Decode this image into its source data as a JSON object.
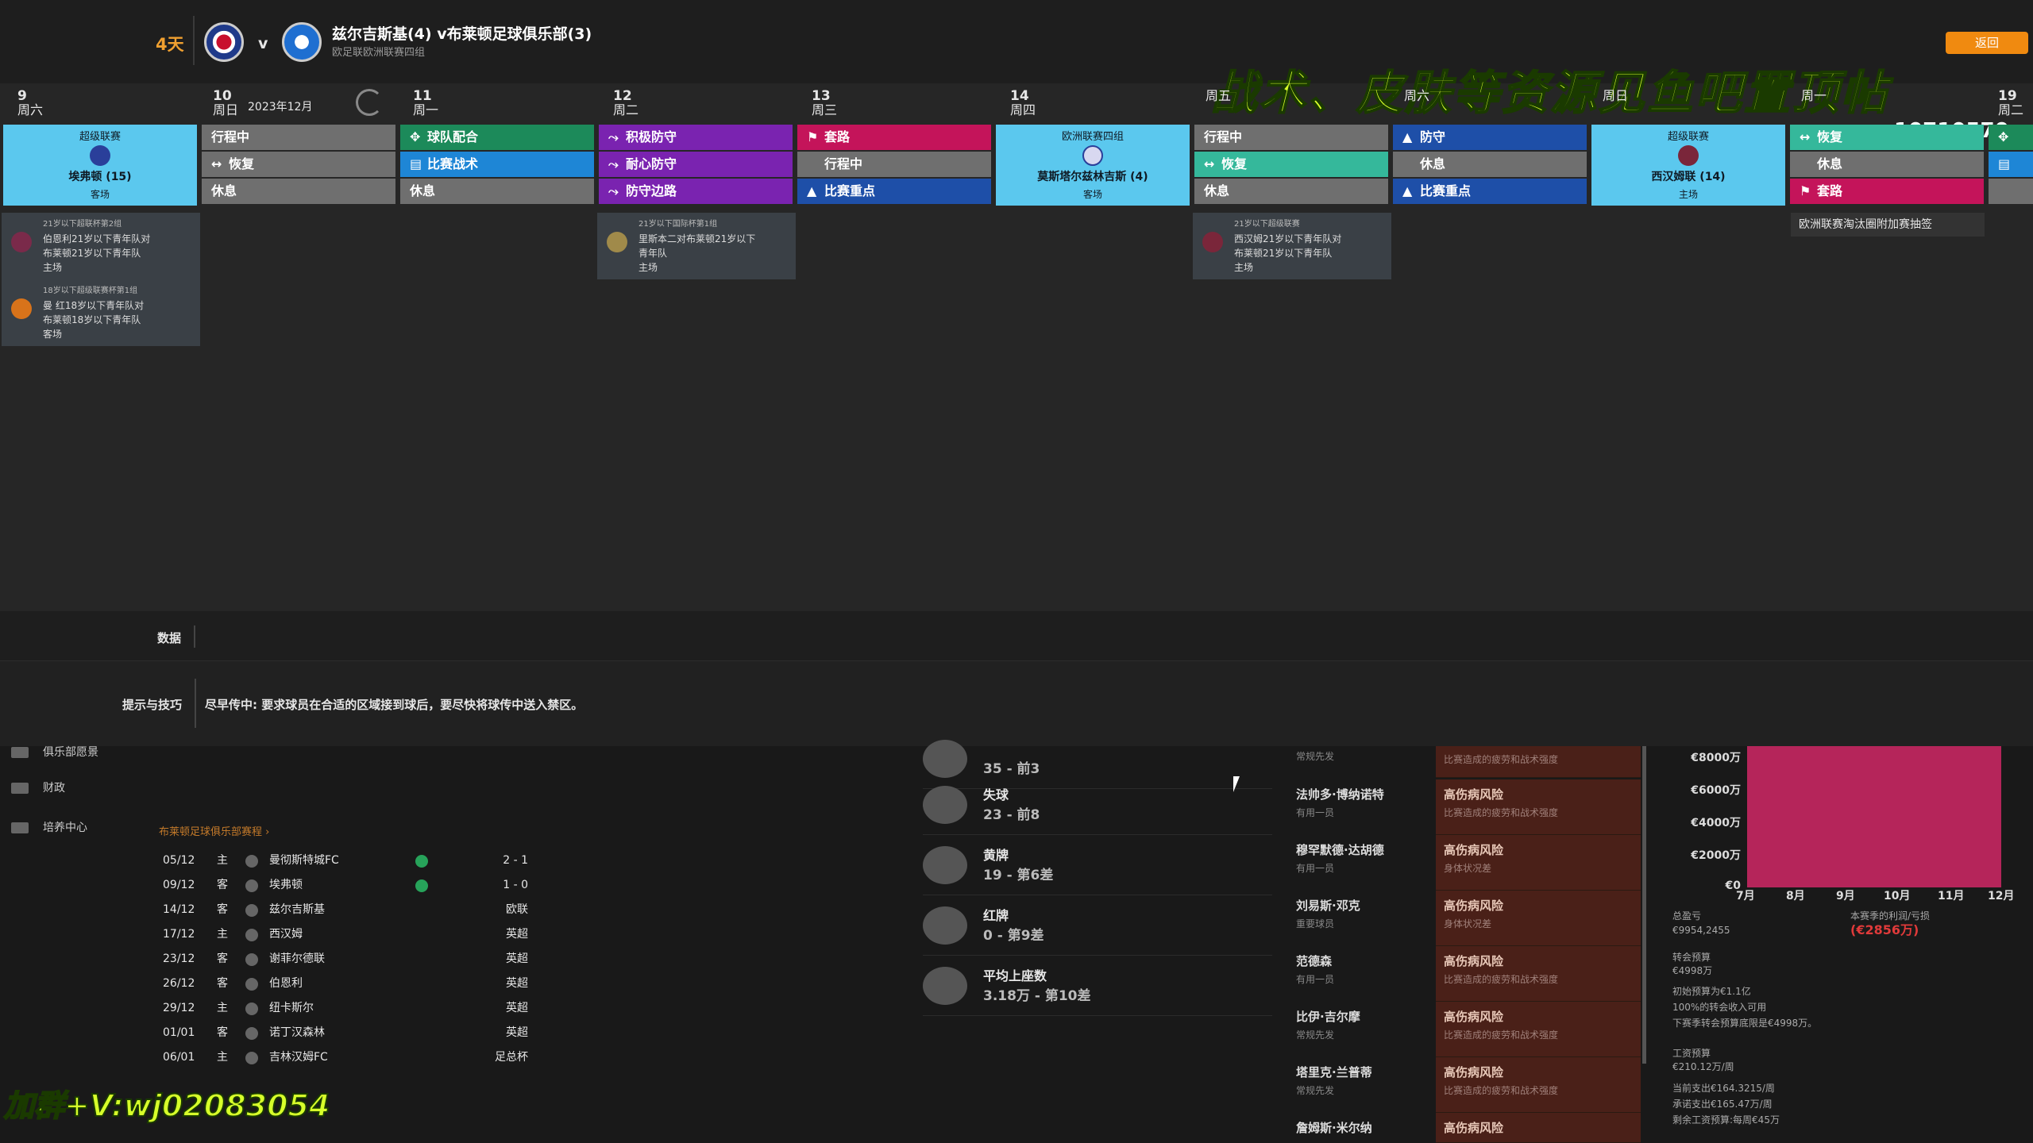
{
  "header": {
    "days_left": "4天",
    "vs": "v",
    "match_title": "兹尔吉斯基(4) v布莱顿足球俱乐部(3)",
    "competition": "欧足联欧洲联赛四组",
    "month": "2023年12月",
    "overlay_text": "战术、皮肤等资源见鱼吧置顶帖",
    "corner_button": "返回",
    "corner_number": "10710570"
  },
  "days": [
    {
      "num": "9",
      "wd": "周六"
    },
    {
      "num": "10",
      "wd": "周日"
    },
    {
      "num": "11",
      "wd": "周一"
    },
    {
      "num": "12",
      "wd": "周二"
    },
    {
      "num": "13",
      "wd": "周三"
    },
    {
      "num": "14",
      "wd": "周四"
    },
    {
      "num": "",
      "wd": "周五"
    },
    {
      "num": "",
      "wd": "周六"
    },
    {
      "num": "",
      "wd": "周日"
    },
    {
      "num": "",
      "wd": "周一"
    },
    {
      "num": "19",
      "wd": "周二"
    }
  ],
  "schedule": {
    "sat9": {
      "comp": "超级联赛",
      "opp": "埃弗顿 (15)",
      "venue": "客场"
    },
    "sun10": [
      "行程中",
      "恢复",
      "休息"
    ],
    "mon11": [
      "球队配合",
      "比赛战术",
      "休息"
    ],
    "tue12": [
      "积极防守",
      "耐心防守",
      "防守边路"
    ],
    "wed13": [
      "套路",
      "行程中",
      "比赛重点"
    ],
    "thu14": {
      "comp": "欧洲联赛四组",
      "opp": "莫斯塔尔兹林吉斯 (4)",
      "venue": "客场"
    },
    "fri": [
      "行程中",
      "恢复",
      "休息"
    ],
    "sat": [
      "防守",
      "休息",
      "比赛重点"
    ],
    "sun": {
      "comp": "超级联赛",
      "opp": "西汉姆联 (14)",
      "venue": "主场"
    },
    "mon": [
      "恢复",
      "休息",
      "套路"
    ]
  },
  "youth": [
    {
      "comp": "21岁以下超联杯第2组",
      "line1": "伯恩利21岁以下青年队对",
      "line2": "布莱顿21岁以下青年队",
      "venue": "主场"
    },
    {
      "comp": "18岁以下超级联赛杯第1组",
      "line1": "曼 红18岁以下青年队对",
      "line2": "布莱顿18岁以下青年队",
      "venue": "客场"
    },
    {
      "comp": "21岁以下国际杯第1组",
      "line1": "里斯本二对布莱顿21岁以下",
      "line2": "青年队",
      "venue": "主场"
    },
    {
      "comp": "21岁以下超级联赛",
      "line1": "西汉姆21岁以下青年队对",
      "line2": "布莱顿21岁以下青年队",
      "venue": "主场"
    }
  ],
  "cup_tag": "欧洲联赛淘汰圈附加赛抽签",
  "data_tab": "数据",
  "tips": {
    "label": "提示与技巧",
    "text": "尽早传中: 要求球员在合适的区域接到球后，要尽快将球传中送入禁区。"
  },
  "nav": [
    "俱乐部愿景",
    "财政",
    "培养中心"
  ],
  "fixtures_link": "布莱顿足球俱乐部赛程 ›",
  "fixtures": [
    {
      "date": "05/12",
      "venue": "主",
      "opp": "曼彻斯特城FC",
      "res": "2 - 1",
      "win": true
    },
    {
      "date": "09/12",
      "venue": "客",
      "opp": "埃弗顿",
      "res": "1 - 0",
      "win": true
    },
    {
      "date": "14/12",
      "venue": "客",
      "opp": "兹尔吉斯基",
      "res": "欧联",
      "win": false
    },
    {
      "date": "17/12",
      "venue": "主",
      "opp": "西汉姆",
      "res": "英超",
      "win": false
    },
    {
      "date": "23/12",
      "venue": "客",
      "opp": "谢菲尔德联",
      "res": "英超",
      "win": false
    },
    {
      "date": "26/12",
      "venue": "客",
      "opp": "伯恩利",
      "res": "英超",
      "win": false
    },
    {
      "date": "29/12",
      "venue": "主",
      "opp": "纽卡斯尔",
      "res": "英超",
      "win": false
    },
    {
      "date": "01/01",
      "venue": "客",
      "opp": "诺丁汉森林",
      "res": "英超",
      "win": false
    },
    {
      "date": "06/01",
      "venue": "主",
      "opp": "吉林汉姆FC",
      "res": "足总杯",
      "win": false
    }
  ],
  "stats": [
    {
      "label": "",
      "value": "35 - 前3"
    },
    {
      "label": "失球",
      "value": "23 - 前8"
    },
    {
      "label": "黄牌",
      "value": "19 - 第6差"
    },
    {
      "label": "红牌",
      "value": "0 - 第9差"
    },
    {
      "label": "平均上座数",
      "value": "3.18万 - 第10差"
    }
  ],
  "players": [
    {
      "name": "",
      "role": "常规先发",
      "risk": "",
      "detail": "比赛造成的疲劳和战术强度"
    },
    {
      "name": "法帅多·博纳诺特",
      "role": "有用一员",
      "risk": "高伤病风险",
      "detail": "比赛造成的疲劳和战术强度"
    },
    {
      "name": "穆罕默德·达胡德",
      "role": "有用一员",
      "risk": "高伤病风险",
      "detail": "身体状况差"
    },
    {
      "name": "刘易斯·邓克",
      "role": "重要球员",
      "risk": "高伤病风险",
      "detail": "身体状况差"
    },
    {
      "name": "范德森",
      "role": "有用一员",
      "risk": "高伤病风险",
      "detail": "比赛造成的疲劳和战术强度"
    },
    {
      "name": "比伊·吉尔摩",
      "role": "常规先发",
      "risk": "高伤病风险",
      "detail": "比赛造成的疲劳和战术强度"
    },
    {
      "name": "塔里克·兰普蒂",
      "role": "常规先发",
      "risk": "高伤病风险",
      "detail": "比赛造成的疲劳和战术强度"
    },
    {
      "name": "詹姆斯·米尔纳",
      "role": "",
      "risk": "高伤病风险",
      "detail": ""
    }
  ],
  "finance": {
    "y_ticks": [
      "€8000万",
      "€6000万",
      "€4000万",
      "€2000万",
      "€0"
    ],
    "x_ticks": [
      "7月",
      "8月",
      "9月",
      "10月",
      "11月",
      "12月"
    ],
    "balance_label": "总盈亏",
    "balance": "€9954,2455",
    "season_label": "本赛季的利润/亏损",
    "season": "(€2856万)",
    "transfer_label": "转会预算",
    "transfer": "€4998万",
    "transfer_l1": "初始预算为€1.1亿",
    "transfer_l2": "100%的转会收入可用",
    "transfer_l3": "下赛季转会预算底限是€4998万。",
    "wage_label": "工资预算",
    "wage": "€210.12万/周",
    "wage_l1": "当前支出€164.3215/周",
    "wage_l2": "承诺支出€165.47万/周",
    "wage_l3": "剩余工资预算:每周€45万"
  },
  "watermark": "加群+V:wj02083054",
  "colors": {
    "match": "#5bc8ee",
    "orange": "#f0a030",
    "overlay": "#d7ff2a"
  }
}
